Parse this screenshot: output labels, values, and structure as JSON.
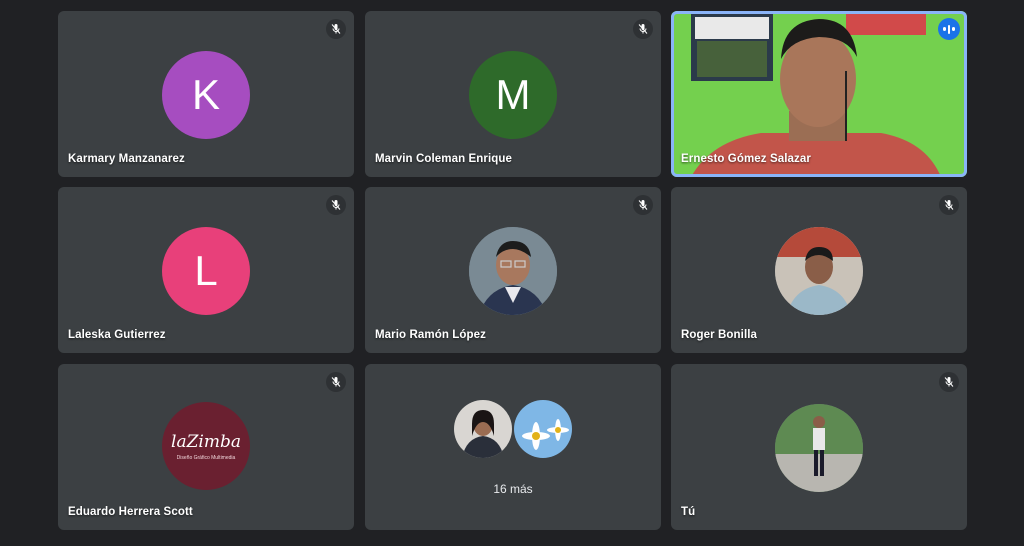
{
  "participants": [
    {
      "name": "Karmary Manzanarez",
      "initial": "K",
      "color": "#a64dc0",
      "muted": true
    },
    {
      "name": "Marvin Coleman Enrique",
      "initial": "M",
      "color": "#2e6a2a",
      "muted": true
    },
    {
      "name": "Ernesto Gómez Salazar",
      "speaking": true
    },
    {
      "name": "Laleska Gutierrez",
      "initial": "L",
      "color": "#e8407a",
      "muted": true
    },
    {
      "name": "Mario Ramón López",
      "muted": true
    },
    {
      "name": "Roger Bonilla",
      "muted": true
    },
    {
      "name": "Eduardo Herrera Scott",
      "muted": true,
      "logo_text": "laZimba",
      "logo_subtext": "Diseño Gráfico Multimedia"
    },
    {
      "name": "Tú",
      "muted": true
    }
  ],
  "overflow": {
    "label": "16 más"
  },
  "icons": {
    "muted": "mic-off-icon",
    "speaking": "audio-bars-icon"
  },
  "colors": {
    "background": "#202124",
    "tile": "#3c4043",
    "speaking_border": "#8ab4f8"
  }
}
